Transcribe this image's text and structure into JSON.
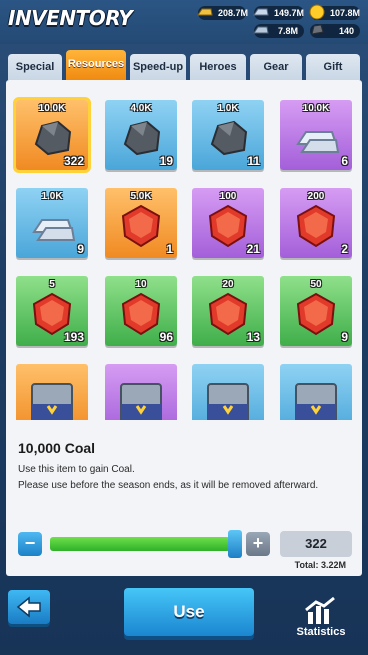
{
  "header": {
    "title": "INVENTORY",
    "resources": [
      {
        "name": "gold-bar-icon",
        "value": "208.7M"
      },
      {
        "name": "iron-ingot-icon",
        "value": "149.7M"
      },
      {
        "name": "coin-icon",
        "value": "107.8M"
      },
      {
        "name": "steel-bar-icon",
        "value": "7.8M"
      },
      {
        "name": "ore-icon",
        "value": "140"
      }
    ]
  },
  "tabs": [
    "Special",
    "Resources",
    "Speed-up",
    "Heroes",
    "Gear",
    "Gift"
  ],
  "active_tab": "Resources",
  "items": [
    {
      "amount": "10.0K",
      "count": "322",
      "rarity": "orange",
      "icon": "coal-icon"
    },
    {
      "amount": "4.0K",
      "count": "19",
      "rarity": "blue",
      "icon": "coal-icon"
    },
    {
      "amount": "1.0K",
      "count": "11",
      "rarity": "blue",
      "icon": "coal-icon"
    },
    {
      "amount": "10.0K",
      "count": "6",
      "rarity": "purple",
      "icon": "iron-ingot-icon"
    },
    {
      "amount": "1.0K",
      "count": "9",
      "rarity": "blue",
      "icon": "iron-ingot-icon"
    },
    {
      "amount": "5.0K",
      "count": "1",
      "rarity": "orange",
      "icon": "ruby-icon"
    },
    {
      "amount": "100",
      "count": "21",
      "rarity": "purple",
      "icon": "ruby-icon"
    },
    {
      "amount": "200",
      "count": "2",
      "rarity": "purple",
      "icon": "ruby-icon"
    },
    {
      "amount": "5",
      "count": "193",
      "rarity": "green",
      "icon": "ruby-icon"
    },
    {
      "amount": "10",
      "count": "96",
      "rarity": "green",
      "icon": "ruby-icon"
    },
    {
      "amount": "20",
      "count": "13",
      "rarity": "green",
      "icon": "ruby-icon"
    },
    {
      "amount": "50",
      "count": "9",
      "rarity": "green",
      "icon": "ruby-icon"
    },
    {
      "amount": "",
      "count": "",
      "rarity": "orange",
      "icon": "chest-icon"
    },
    {
      "amount": "",
      "count": "",
      "rarity": "purple",
      "icon": "chest-icon"
    },
    {
      "amount": "",
      "count": "",
      "rarity": "blue",
      "icon": "chest-icon"
    },
    {
      "amount": "",
      "count": "",
      "rarity": "blue",
      "icon": "chest-icon"
    }
  ],
  "selected_index": 0,
  "detail": {
    "name": "10,000 Coal",
    "desc_line1": "Use this item to gain Coal.",
    "desc_line2": "Please use before the season ends, as it will be removed afterward."
  },
  "quantity": {
    "value": "322",
    "fill_fraction": 1.0,
    "total": "Total: 3.22M",
    "minus": "−",
    "plus": "+"
  },
  "bottom": {
    "use_label": "Use",
    "stats_label": "Statistics"
  }
}
